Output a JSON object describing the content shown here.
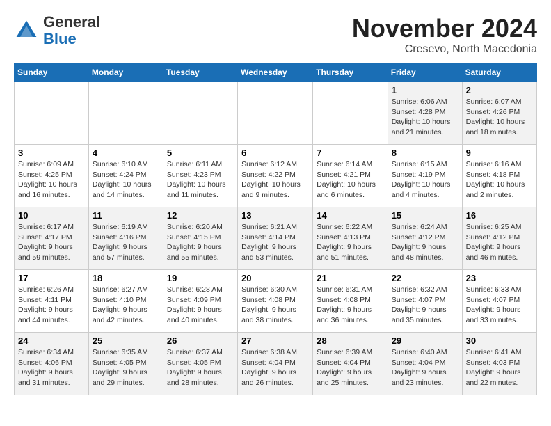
{
  "logo": {
    "text_general": "General",
    "text_blue": "Blue"
  },
  "header": {
    "month_title": "November 2024",
    "location": "Cresevo, North Macedonia"
  },
  "weekdays": [
    "Sunday",
    "Monday",
    "Tuesday",
    "Wednesday",
    "Thursday",
    "Friday",
    "Saturday"
  ],
  "weeks": [
    [
      {
        "day": "",
        "info": ""
      },
      {
        "day": "",
        "info": ""
      },
      {
        "day": "",
        "info": ""
      },
      {
        "day": "",
        "info": ""
      },
      {
        "day": "",
        "info": ""
      },
      {
        "day": "1",
        "info": "Sunrise: 6:06 AM\nSunset: 4:28 PM\nDaylight: 10 hours and 21 minutes."
      },
      {
        "day": "2",
        "info": "Sunrise: 6:07 AM\nSunset: 4:26 PM\nDaylight: 10 hours and 18 minutes."
      }
    ],
    [
      {
        "day": "3",
        "info": "Sunrise: 6:09 AM\nSunset: 4:25 PM\nDaylight: 10 hours and 16 minutes."
      },
      {
        "day": "4",
        "info": "Sunrise: 6:10 AM\nSunset: 4:24 PM\nDaylight: 10 hours and 14 minutes."
      },
      {
        "day": "5",
        "info": "Sunrise: 6:11 AM\nSunset: 4:23 PM\nDaylight: 10 hours and 11 minutes."
      },
      {
        "day": "6",
        "info": "Sunrise: 6:12 AM\nSunset: 4:22 PM\nDaylight: 10 hours and 9 minutes."
      },
      {
        "day": "7",
        "info": "Sunrise: 6:14 AM\nSunset: 4:21 PM\nDaylight: 10 hours and 6 minutes."
      },
      {
        "day": "8",
        "info": "Sunrise: 6:15 AM\nSunset: 4:19 PM\nDaylight: 10 hours and 4 minutes."
      },
      {
        "day": "9",
        "info": "Sunrise: 6:16 AM\nSunset: 4:18 PM\nDaylight: 10 hours and 2 minutes."
      }
    ],
    [
      {
        "day": "10",
        "info": "Sunrise: 6:17 AM\nSunset: 4:17 PM\nDaylight: 9 hours and 59 minutes."
      },
      {
        "day": "11",
        "info": "Sunrise: 6:19 AM\nSunset: 4:16 PM\nDaylight: 9 hours and 57 minutes."
      },
      {
        "day": "12",
        "info": "Sunrise: 6:20 AM\nSunset: 4:15 PM\nDaylight: 9 hours and 55 minutes."
      },
      {
        "day": "13",
        "info": "Sunrise: 6:21 AM\nSunset: 4:14 PM\nDaylight: 9 hours and 53 minutes."
      },
      {
        "day": "14",
        "info": "Sunrise: 6:22 AM\nSunset: 4:13 PM\nDaylight: 9 hours and 51 minutes."
      },
      {
        "day": "15",
        "info": "Sunrise: 6:24 AM\nSunset: 4:12 PM\nDaylight: 9 hours and 48 minutes."
      },
      {
        "day": "16",
        "info": "Sunrise: 6:25 AM\nSunset: 4:12 PM\nDaylight: 9 hours and 46 minutes."
      }
    ],
    [
      {
        "day": "17",
        "info": "Sunrise: 6:26 AM\nSunset: 4:11 PM\nDaylight: 9 hours and 44 minutes."
      },
      {
        "day": "18",
        "info": "Sunrise: 6:27 AM\nSunset: 4:10 PM\nDaylight: 9 hours and 42 minutes."
      },
      {
        "day": "19",
        "info": "Sunrise: 6:28 AM\nSunset: 4:09 PM\nDaylight: 9 hours and 40 minutes."
      },
      {
        "day": "20",
        "info": "Sunrise: 6:30 AM\nSunset: 4:08 PM\nDaylight: 9 hours and 38 minutes."
      },
      {
        "day": "21",
        "info": "Sunrise: 6:31 AM\nSunset: 4:08 PM\nDaylight: 9 hours and 36 minutes."
      },
      {
        "day": "22",
        "info": "Sunrise: 6:32 AM\nSunset: 4:07 PM\nDaylight: 9 hours and 35 minutes."
      },
      {
        "day": "23",
        "info": "Sunrise: 6:33 AM\nSunset: 4:07 PM\nDaylight: 9 hours and 33 minutes."
      }
    ],
    [
      {
        "day": "24",
        "info": "Sunrise: 6:34 AM\nSunset: 4:06 PM\nDaylight: 9 hours and 31 minutes."
      },
      {
        "day": "25",
        "info": "Sunrise: 6:35 AM\nSunset: 4:05 PM\nDaylight: 9 hours and 29 minutes."
      },
      {
        "day": "26",
        "info": "Sunrise: 6:37 AM\nSunset: 4:05 PM\nDaylight: 9 hours and 28 minutes."
      },
      {
        "day": "27",
        "info": "Sunrise: 6:38 AM\nSunset: 4:04 PM\nDaylight: 9 hours and 26 minutes."
      },
      {
        "day": "28",
        "info": "Sunrise: 6:39 AM\nSunset: 4:04 PM\nDaylight: 9 hours and 25 minutes."
      },
      {
        "day": "29",
        "info": "Sunrise: 6:40 AM\nSunset: 4:04 PM\nDaylight: 9 hours and 23 minutes."
      },
      {
        "day": "30",
        "info": "Sunrise: 6:41 AM\nSunset: 4:03 PM\nDaylight: 9 hours and 22 minutes."
      }
    ]
  ]
}
